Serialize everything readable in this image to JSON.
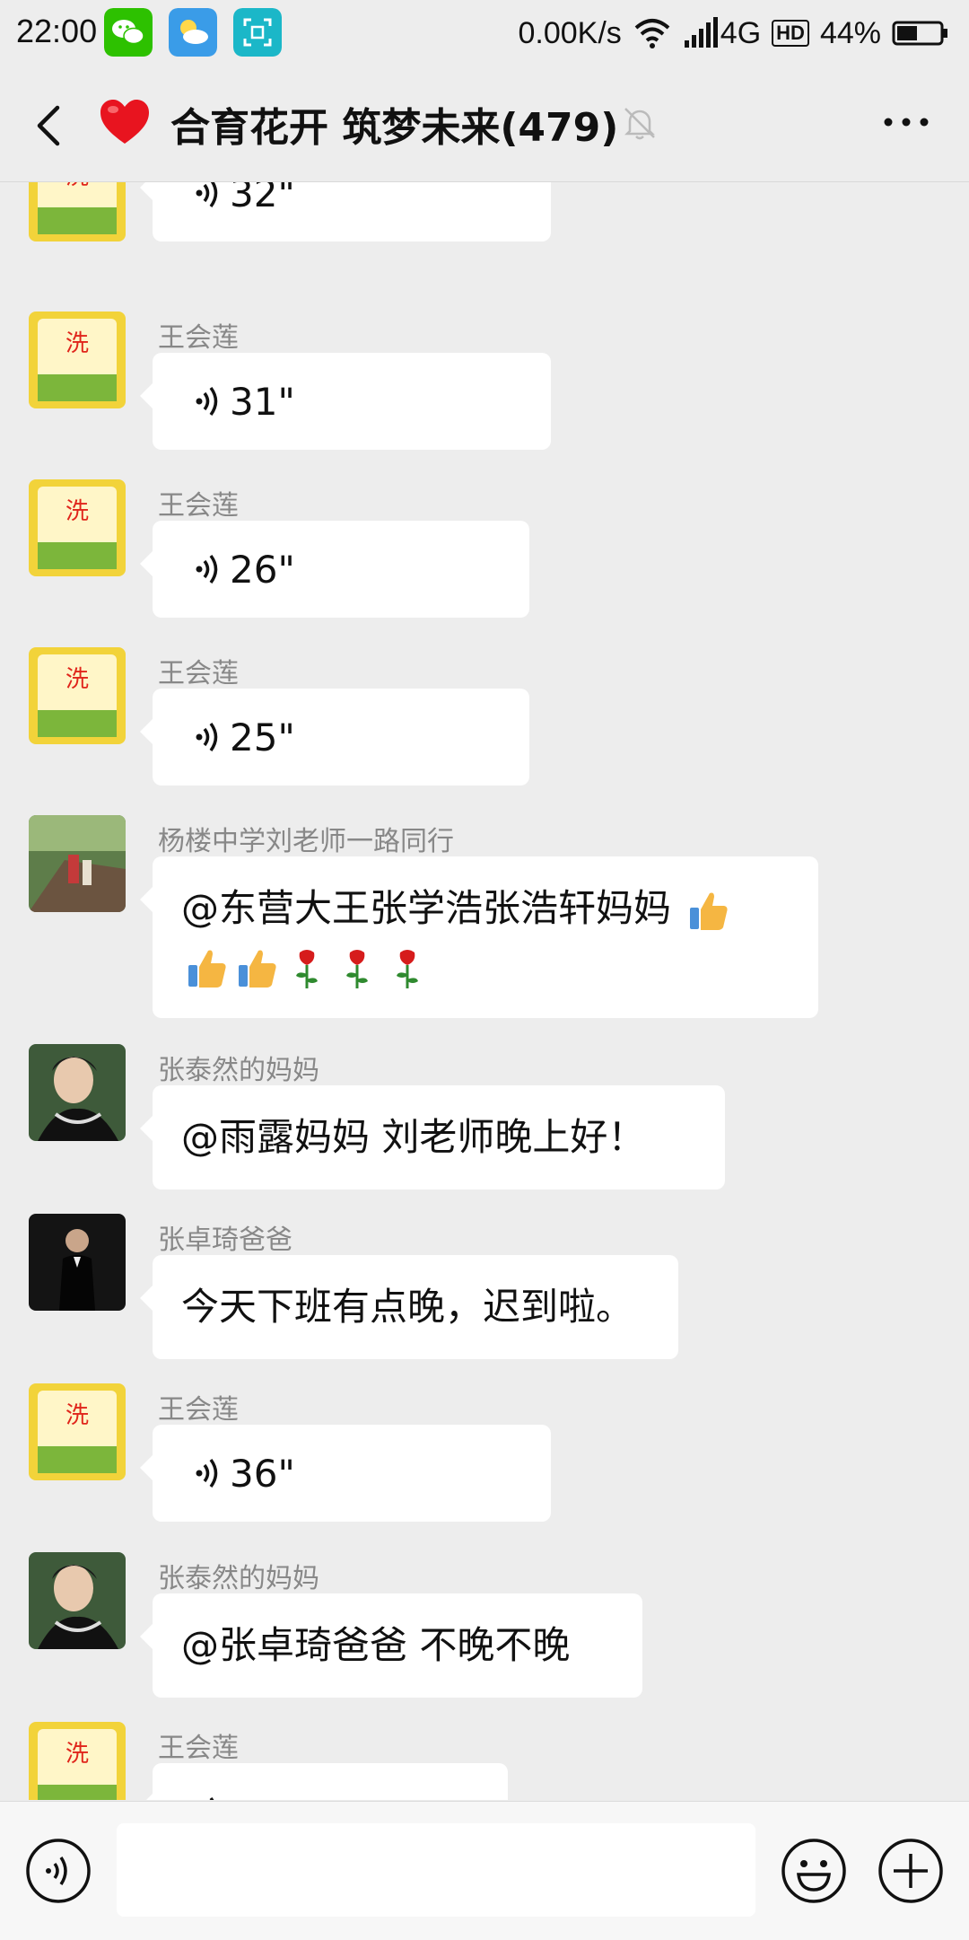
{
  "status_bar": {
    "time": "22:00",
    "network_speed": "0.00K/s",
    "network_type": "4G",
    "hd_label": "HD",
    "battery": "44%",
    "icons": [
      "wechat-icon",
      "weather-icon",
      "scan-icon",
      "wifi-icon",
      "signal-icon",
      "battery-icon"
    ]
  },
  "header": {
    "title": "合育花开 筑梦未来(479)",
    "icons": [
      "back-icon",
      "heart-icon",
      "mute-bell-icon",
      "more-icon"
    ]
  },
  "messages": [
    {
      "sender": "",
      "type": "voice",
      "duration": "32\""
    },
    {
      "sender": "王会莲",
      "type": "voice",
      "duration": "31\""
    },
    {
      "sender": "王会莲",
      "type": "voice",
      "duration": "26\""
    },
    {
      "sender": "王会莲",
      "type": "voice",
      "duration": "25\""
    },
    {
      "sender": "杨楼中学刘老师一路同行",
      "type": "text",
      "text": "@东营大王张学浩张浩轩妈妈",
      "emojis": [
        "thumbs-up",
        "thumbs-up",
        "thumbs-up",
        "rose",
        "rose",
        "rose"
      ]
    },
    {
      "sender": "张泰然的妈妈",
      "type": "text",
      "text": "@雨露妈妈  刘老师晚上好！"
    },
    {
      "sender": "张卓琦爸爸",
      "type": "text",
      "text": "今天下班有点晚，迟到啦。"
    },
    {
      "sender": "王会莲",
      "type": "voice",
      "duration": "36\""
    },
    {
      "sender": "张泰然的妈妈",
      "type": "text",
      "text": "@张卓琦爸爸  不晚不晚"
    },
    {
      "sender": "王会莲",
      "type": "voice",
      "duration": ""
    }
  ],
  "input_bar": {
    "icons": [
      "voice-input-icon",
      "emoji-icon",
      "plus-icon"
    ]
  },
  "colors": {
    "background": "#ededed",
    "bubble": "#ffffff",
    "wechat_green": "#07c160"
  }
}
